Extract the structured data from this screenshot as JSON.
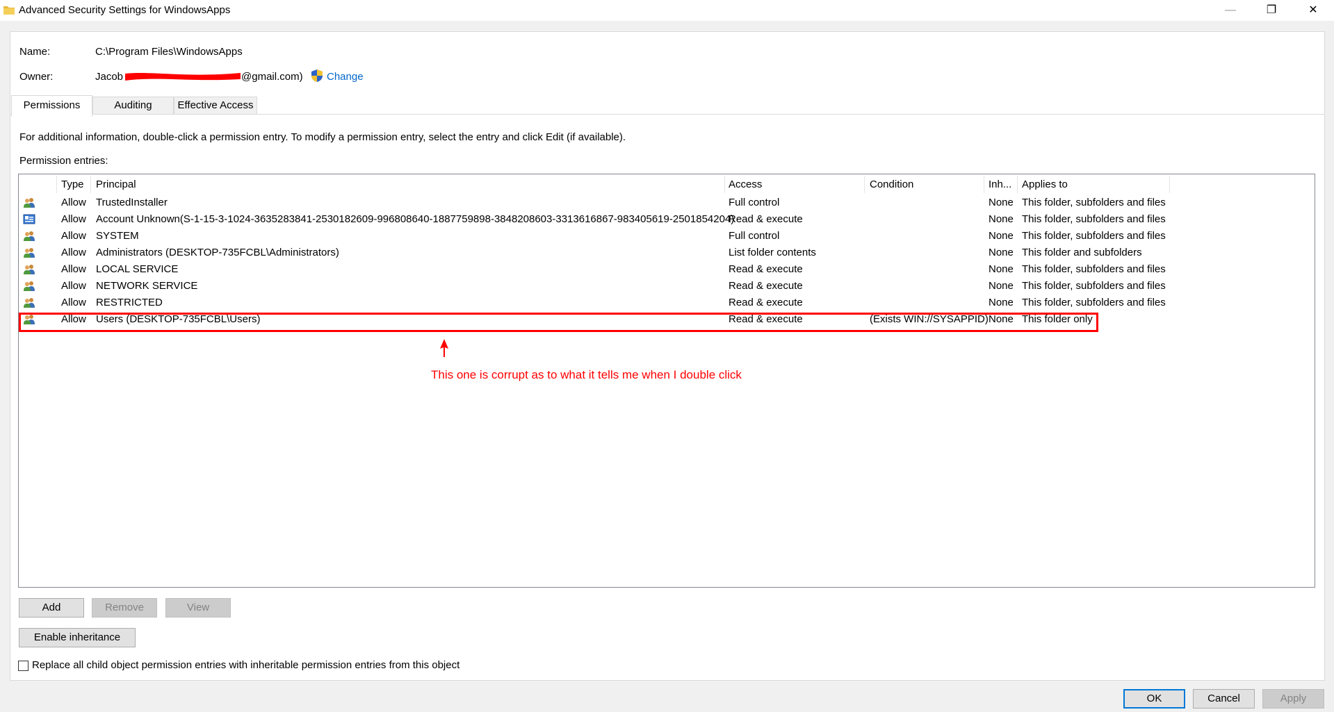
{
  "window": {
    "title": "Advanced Security Settings for WindowsApps",
    "minimize_glyph": "—",
    "restore_glyph": "❐",
    "close_glyph": "✕"
  },
  "info": {
    "name_label": "Name:",
    "name_value": "C:\\Program Files\\WindowsApps",
    "owner_label": "Owner:",
    "owner_first": "Jacob",
    "owner_email_suffix": "@gmail.com)",
    "change_link": "Change"
  },
  "tabs": [
    {
      "label": "Permissions",
      "active": true
    },
    {
      "label": "Auditing",
      "active": false
    },
    {
      "label": "Effective Access",
      "active": false
    }
  ],
  "instructions": "For additional information, double-click a permission entry. To modify a permission entry, select the entry and click Edit (if available).",
  "entries_label": "Permission entries:",
  "columns": {
    "type": "Type",
    "principal": "Principal",
    "access": "Access",
    "condition": "Condition",
    "inherited": "Inh...",
    "applies": "Applies to"
  },
  "rows": [
    {
      "icon": "user-group-icon",
      "type": "Allow",
      "principal": "TrustedInstaller",
      "access": "Full control",
      "condition": "",
      "inherited": "None",
      "applies": "This folder, subfolders and files"
    },
    {
      "icon": "unknown-account-icon",
      "type": "Allow",
      "principal": "Account Unknown(S-1-15-3-1024-3635283841-2530182609-996808640-1887759898-3848208603-3313616867-983405619-2501854204)",
      "access": "Read & execute",
      "condition": "",
      "inherited": "None",
      "applies": "This folder, subfolders and files"
    },
    {
      "icon": "user-group-icon",
      "type": "Allow",
      "principal": "SYSTEM",
      "access": "Full control",
      "condition": "",
      "inherited": "None",
      "applies": "This folder, subfolders and files"
    },
    {
      "icon": "user-group-icon",
      "type": "Allow",
      "principal": "Administrators (DESKTOP-735FCBL\\Administrators)",
      "access": "List folder contents",
      "condition": "",
      "inherited": "None",
      "applies": "This folder and subfolders"
    },
    {
      "icon": "user-group-icon",
      "type": "Allow",
      "principal": "LOCAL SERVICE",
      "access": "Read & execute",
      "condition": "",
      "inherited": "None",
      "applies": "This folder, subfolders and files"
    },
    {
      "icon": "user-group-icon",
      "type": "Allow",
      "principal": "NETWORK SERVICE",
      "access": "Read & execute",
      "condition": "",
      "inherited": "None",
      "applies": "This folder, subfolders and files"
    },
    {
      "icon": "user-group-icon",
      "type": "Allow",
      "principal": "RESTRICTED",
      "access": "Read & execute",
      "condition": "",
      "inherited": "None",
      "applies": "This folder, subfolders and files"
    },
    {
      "icon": "user-group-icon",
      "type": "Allow",
      "principal": "Users (DESKTOP-735FCBL\\Users)",
      "access": "Read & execute",
      "condition": "(Exists WIN://SYSAPPID)",
      "inherited": "None",
      "applies": "This folder only"
    }
  ],
  "annotation": {
    "text": "This one is corrupt as to what it tells me when I double click",
    "color": "#ff0000"
  },
  "buttons": {
    "add": "Add",
    "remove": "Remove",
    "view": "View",
    "enable_inheritance": "Enable inheritance",
    "ok": "OK",
    "cancel": "Cancel",
    "apply": "Apply"
  },
  "replace_checkbox": {
    "label": "Replace all child object permission entries with inheritable permission entries from this object",
    "checked": false
  },
  "colors": {
    "link": "#0066cc",
    "accent": "#0078d7",
    "annotation": "#ff0000"
  }
}
